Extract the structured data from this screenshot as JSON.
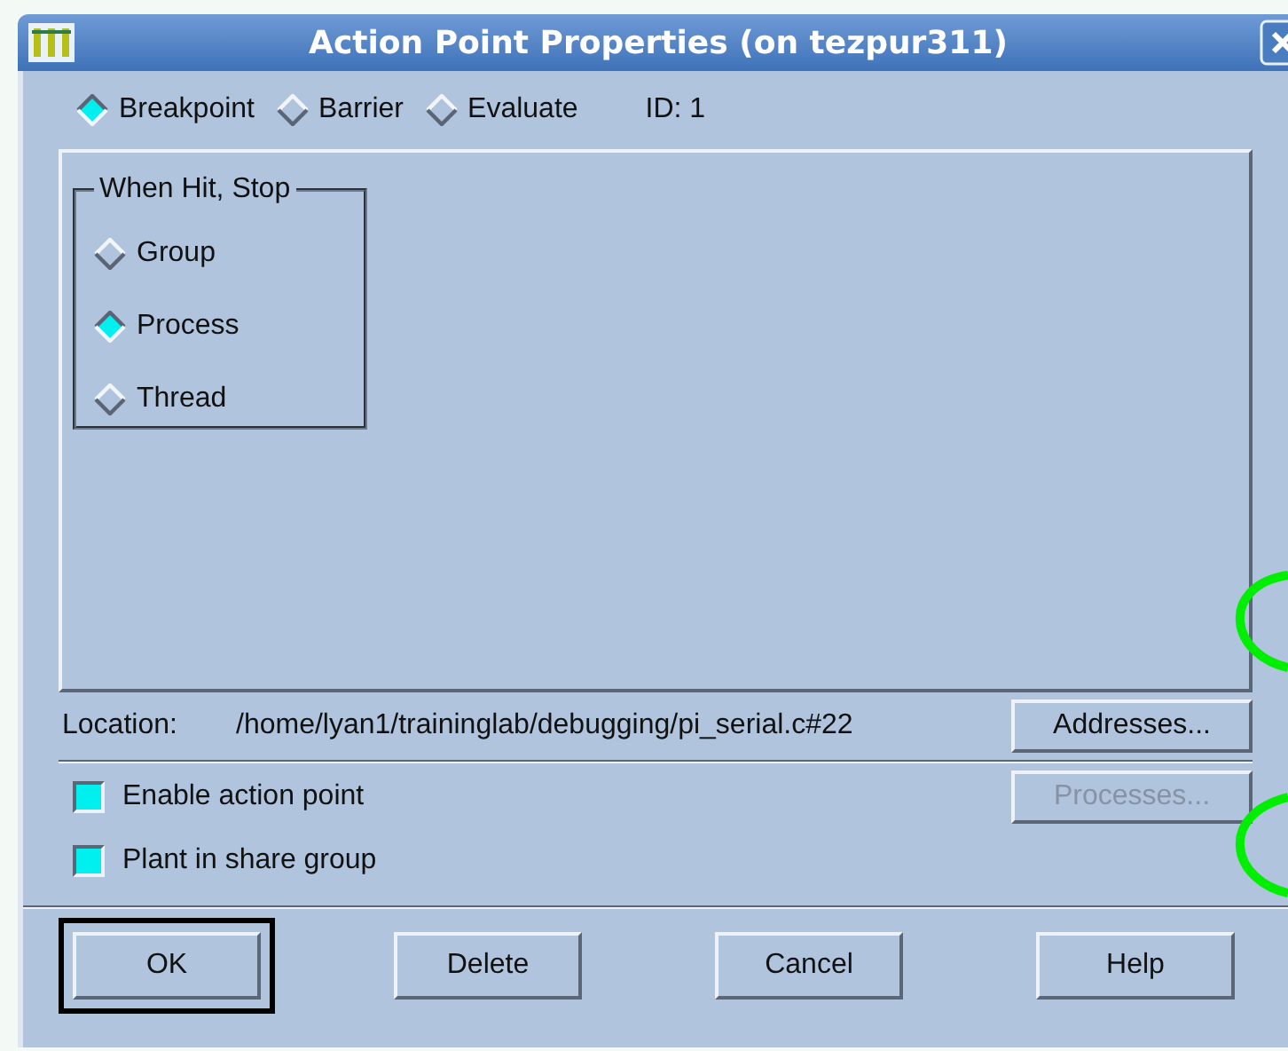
{
  "window": {
    "title": "Action Point Properties (on tezpur311)"
  },
  "type_options": [
    {
      "label": "Breakpoint",
      "selected": true
    },
    {
      "label": "Barrier",
      "selected": false
    },
    {
      "label": "Evaluate",
      "selected": false
    }
  ],
  "id_label": "ID: 1",
  "stop_group": {
    "title": "When Hit, Stop",
    "options": [
      {
        "label": "Group",
        "selected": false
      },
      {
        "label": "Process",
        "selected": true
      },
      {
        "label": "Thread",
        "selected": false
      }
    ]
  },
  "location": {
    "label": "Location:",
    "value": "/home/lyan1/traininglab/debugging/pi_serial.c#22",
    "button": {
      "label": "Addresses...",
      "disabled": false
    }
  },
  "checkboxes": [
    {
      "label": "Enable action point",
      "checked": true
    },
    {
      "label": "Plant in share group",
      "checked": true
    }
  ],
  "processes_button": {
    "label": "Processes...",
    "disabled": true
  },
  "buttons": [
    {
      "label": "OK",
      "default": true
    },
    {
      "label": "Delete",
      "default": false
    },
    {
      "label": "Cancel",
      "default": false
    },
    {
      "label": "Help",
      "default": false
    }
  ]
}
